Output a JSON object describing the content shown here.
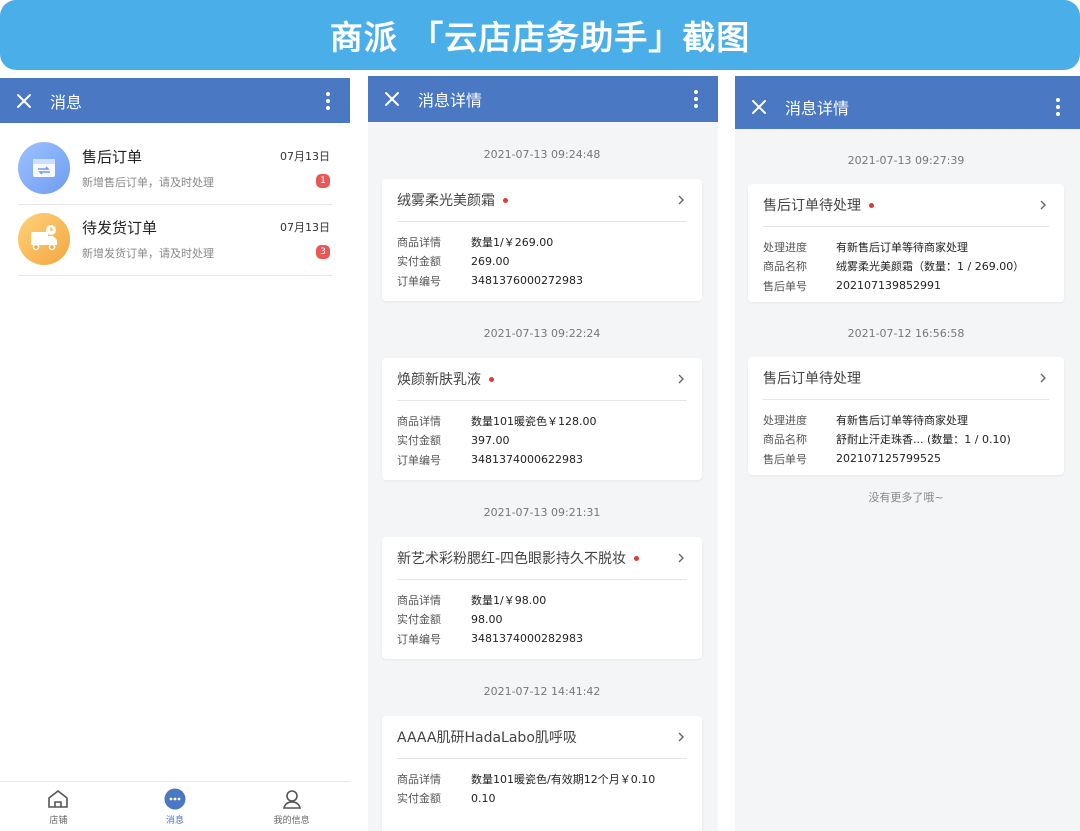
{
  "banner": {
    "title": "商派 「云店店务助手」截图"
  },
  "panel1": {
    "title": "消息",
    "items": [
      {
        "title": "售后订单",
        "date": "07月13日",
        "subtitle": "新增售后订单，请及时处理",
        "badge": "1",
        "icon": "refund-order-icon"
      },
      {
        "title": "待发货订单",
        "date": "07月13日",
        "subtitle": "新增发货订单，请及时处理",
        "badge": "3",
        "icon": "delivery-truck-icon"
      }
    ],
    "nav": [
      {
        "label": "店铺",
        "icon": "store-icon"
      },
      {
        "label": "消息",
        "icon": "message-icon"
      },
      {
        "label": "我的信息",
        "icon": "profile-icon"
      }
    ]
  },
  "panel2": {
    "title": "消息详情",
    "entries": [
      {
        "time": "2021-07-13 09:24:48",
        "name": "绒雾柔光美颜霜",
        "unread": true,
        "rows": [
          {
            "k": "商品详情",
            "v": "数量1/￥269.00"
          },
          {
            "k": "实付金额",
            "v": "269.00"
          },
          {
            "k": "订单编号",
            "v": "3481376000272983"
          }
        ]
      },
      {
        "time": "2021-07-13 09:22:24",
        "name": "焕颜新肤乳液",
        "unread": true,
        "rows": [
          {
            "k": "商品详情",
            "v": "数量101暖瓷色￥128.00"
          },
          {
            "k": "实付金额",
            "v": "397.00"
          },
          {
            "k": "订单编号",
            "v": "3481374000622983"
          }
        ]
      },
      {
        "time": "2021-07-13 09:21:31",
        "name": "新艺术彩粉腮红-四色眼影持久不脱妆",
        "unread": true,
        "rows": [
          {
            "k": "商品详情",
            "v": "数量1/￥98.00"
          },
          {
            "k": "实付金额",
            "v": "98.00"
          },
          {
            "k": "订单编号",
            "v": "3481374000282983"
          }
        ]
      },
      {
        "time": "2021-07-12 14:41:42",
        "name": "AAAA肌研HadaLabo肌呼吸",
        "unread": false,
        "rows": [
          {
            "k": "商品详情",
            "v": "数量101暖瓷色/有效期12个月￥0.10"
          },
          {
            "k": "实付金额",
            "v": "0.10"
          }
        ]
      }
    ]
  },
  "panel3": {
    "title": "消息详情",
    "entries": [
      {
        "time": "2021-07-13 09:27:39",
        "name": "售后订单待处理",
        "unread": true,
        "rows": [
          {
            "k": "处理进度",
            "v": "有新售后订单等待商家处理"
          },
          {
            "k": "商品名称",
            "v": "绒雾柔光美颜霜（数量：1 / 269.00）"
          },
          {
            "k": "售后单号",
            "v": "202107139852991"
          }
        ]
      },
      {
        "time": "2021-07-12 16:56:58",
        "name": "售后订单待处理",
        "unread": false,
        "rows": [
          {
            "k": "处理进度",
            "v": "有新售后订单等待商家处理"
          },
          {
            "k": "商品名称",
            "v": "舒耐止汗走珠香...  (数量：1 / 0.10)"
          },
          {
            "k": "售后单号",
            "v": "202107125799525"
          }
        ]
      }
    ],
    "no_more": "没有更多了哦~"
  },
  "colors": {
    "accent": "#4a78c2",
    "banner": "#4aaee8",
    "badge": "#e85858",
    "unread_dot": "#e03a3a"
  }
}
